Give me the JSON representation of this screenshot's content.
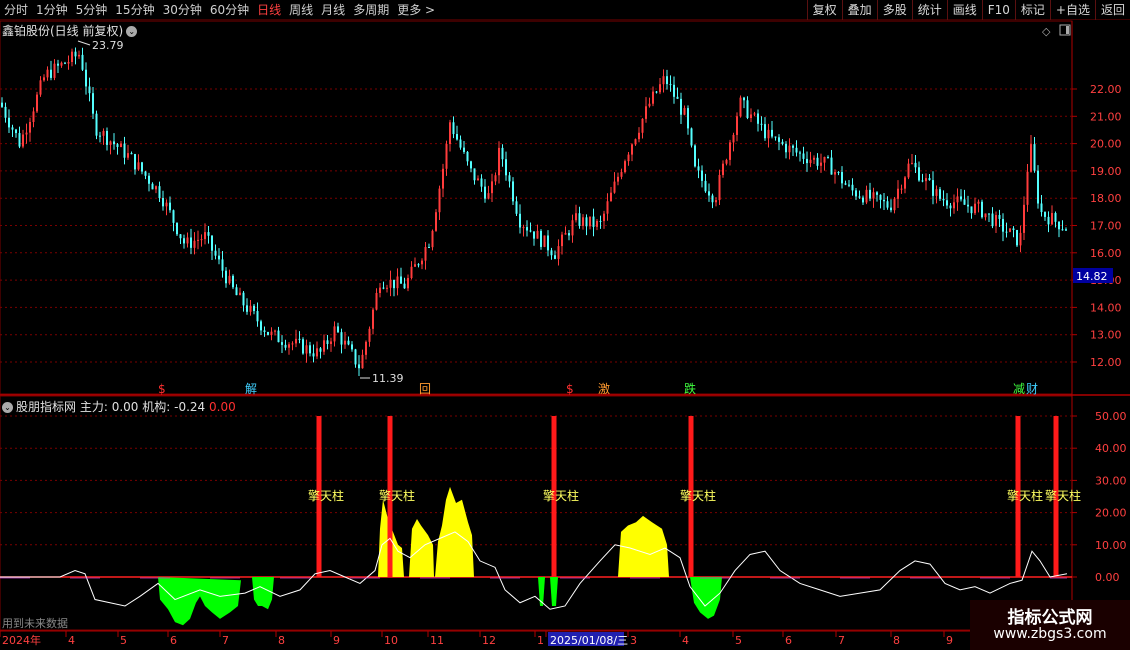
{
  "toolbar": {
    "periods": [
      "分时",
      "1分钟",
      "5分钟",
      "15分钟",
      "30分钟",
      "60分钟",
      "日线",
      "周线",
      "月线",
      "多周期",
      "更多 >"
    ],
    "active_index": 6,
    "right_buttons": [
      "复权",
      "叠加",
      "多股",
      "统计",
      "画线",
      "F10",
      "标记",
      "+自选",
      "返回"
    ]
  },
  "stock": {
    "title": "鑫铂股份(日线 前复权)",
    "high_label": "23.79",
    "low_label": "11.39",
    "current_price": "14.82",
    "price_axis": [
      "22.00",
      "21.00",
      "20.00",
      "19.00",
      "18.00",
      "17.00",
      "16.00",
      "15.00",
      "14.00",
      "13.00",
      "12.00"
    ]
  },
  "event_markers": [
    {
      "text": "$",
      "color": "#ff3030"
    },
    {
      "text": "解",
      "color": "#40d0ff"
    },
    {
      "text": "回",
      "color": "#ff9a30"
    },
    {
      "text": "$",
      "color": "#ff3030"
    },
    {
      "text": "激",
      "color": "#ff9a30"
    },
    {
      "text": "跌",
      "color": "#40ff40"
    },
    {
      "text": "减",
      "color": "#40ff40"
    },
    {
      "text": "财",
      "color": "#40d0ff"
    }
  ],
  "indicator": {
    "name": "股朋指标网",
    "main_label": "主力: 0.00",
    "inst_label": "机构: -0.24",
    "extra_value": "0.00",
    "axis": [
      "50.00",
      "40.00",
      "30.00",
      "20.00",
      "10.00",
      "0.00"
    ],
    "pillar_label": "擎天柱"
  },
  "future_note": "用到未来数据",
  "date_axis": {
    "labels": [
      "2024年",
      "4",
      "5",
      "6",
      "7",
      "8",
      "9",
      "10",
      "11",
      "12",
      "1",
      "2025/01/08/三",
      "3",
      "4",
      "5",
      "6",
      "7",
      "8",
      "9"
    ]
  },
  "watermark": {
    "title": "指标公式网",
    "url": "www.zbgs3.com"
  },
  "colors": {
    "up": "#ff3c3c",
    "down": "#54ffff",
    "grid": "#7a0000",
    "pillar": "#ff1a1a",
    "yellow": "#ffff00",
    "green": "#00ff00",
    "current_price_bg": "#0000a0"
  }
}
